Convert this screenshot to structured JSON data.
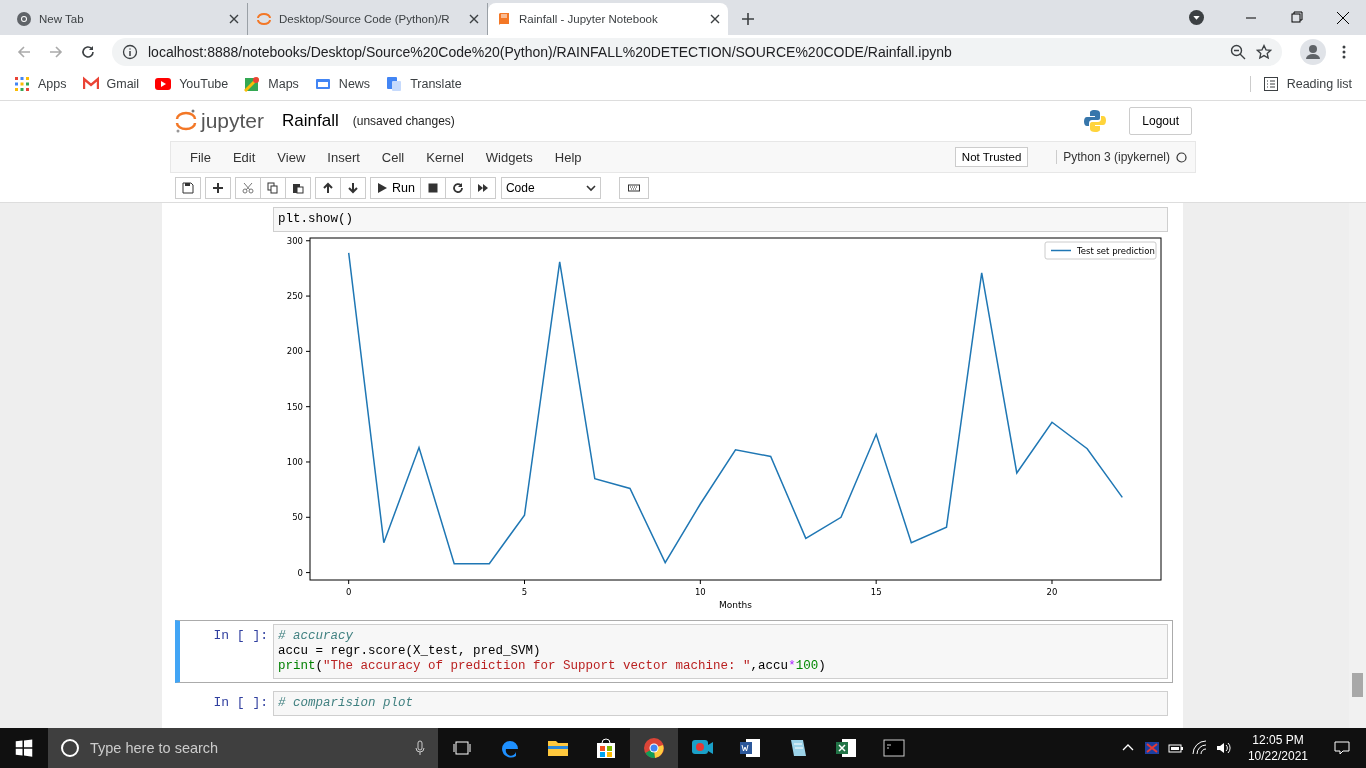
{
  "browser": {
    "tabs": [
      {
        "title": "New Tab",
        "selected": false,
        "kind": "newtab"
      },
      {
        "title": "Desktop/Source Code (Python)/R",
        "selected": false,
        "kind": "jupyter"
      },
      {
        "title": "Rainfall - Jupyter Notebook",
        "selected": true,
        "kind": "notebook"
      }
    ],
    "url": "localhost:8888/notebooks/Desktop/Source%20Code%20(Python)/RAINFALL%20DETECTION/SOURCE%20CODE/Rainfall.ipynb",
    "bookmarks": [
      {
        "label": "Apps",
        "kind": "apps"
      },
      {
        "label": "Gmail",
        "kind": "mail"
      },
      {
        "label": "YouTube",
        "kind": "video"
      },
      {
        "label": "Maps",
        "kind": "map"
      },
      {
        "label": "News",
        "kind": "news"
      },
      {
        "label": "Translate",
        "kind": "translate"
      }
    ],
    "reading_list": "Reading list"
  },
  "jupyter": {
    "logo": "jupyter",
    "notebook_name": "Rainfall",
    "save_status": "(unsaved changes)",
    "logout": "Logout",
    "menu": [
      "File",
      "Edit",
      "View",
      "Insert",
      "Cell",
      "Kernel",
      "Widgets",
      "Help"
    ],
    "trust": "Not Trusted",
    "kernel": "Python 3 (ipykernel)",
    "run": "Run",
    "cell_type": "Code"
  },
  "cells": [
    {
      "selected": false,
      "lines": [
        [
          {
            "kind": "plain",
            "text": "plt.show()"
          }
        ]
      ],
      "output": {
        "chart_data": {
          "type": "line",
          "xlabel": "Months",
          "x": [
            0,
            1,
            2,
            3,
            4,
            5,
            6,
            7,
            8,
            9,
            10,
            11,
            12,
            13,
            14,
            15,
            16,
            17,
            18,
            19,
            20,
            21,
            22
          ],
          "series": [
            {
              "name": "Test set prediction",
              "color": "#1f77b4",
              "values": [
                289,
                27,
                113,
                8,
                8,
                52,
                281,
                85,
                76,
                9,
                62,
                111,
                105,
                31,
                50,
                125,
                27,
                41,
                271,
                90,
                136,
                112,
                68
              ]
            }
          ],
          "xlim": [
            -1.1,
            23.1
          ],
          "ylim": [
            -6.7,
            302.5
          ],
          "xticks": [
            0,
            5,
            10,
            15,
            20
          ],
          "yticks": [
            0,
            50,
            100,
            150,
            200,
            250,
            300
          ]
        }
      }
    },
    {
      "prompt": "In [ ]:",
      "selected": true,
      "lines": [
        [
          {
            "kind": "comment",
            "text": "# accuracy"
          }
        ],
        [
          {
            "kind": "plain",
            "text": "accu = regr.score(X_test, pred_SVM)"
          }
        ],
        [
          {
            "kind": "builtin",
            "text": "print"
          },
          {
            "kind": "plain",
            "text": "("
          },
          {
            "kind": "string",
            "text": "\"The accuracy of prediction for Support vector machine: \""
          },
          {
            "kind": "plain",
            "text": ",accu"
          },
          {
            "kind": "operator",
            "text": "*"
          },
          {
            "kind": "number",
            "text": "100"
          },
          {
            "kind": "plain",
            "text": ")"
          }
        ]
      ]
    },
    {
      "prompt": "In [ ]:",
      "selected": false,
      "lines": [
        [
          {
            "kind": "comment",
            "text": "# comparision plot"
          }
        ]
      ]
    }
  ],
  "taskbar": {
    "search_placeholder": "Type here to search",
    "time": "12:05 PM",
    "date": "10/22/2021"
  }
}
